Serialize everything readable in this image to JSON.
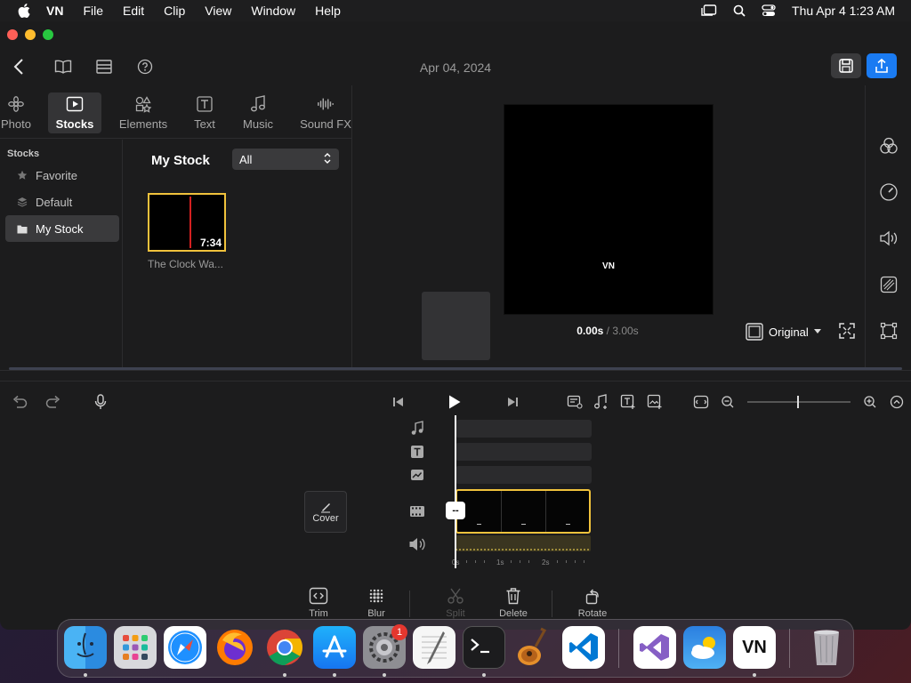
{
  "menubar": {
    "app_name": "VN",
    "menus": [
      "File",
      "Edit",
      "Clip",
      "View",
      "Window",
      "Help"
    ],
    "datetime": "Thu Apr 4  1:23 AM"
  },
  "window": {
    "title": "Apr 04, 2024"
  },
  "library": {
    "tabs": [
      {
        "label": "Photo",
        "icon": "photo-icon"
      },
      {
        "label": "Stocks",
        "icon": "stocks-icon",
        "active": true
      },
      {
        "label": "Elements",
        "icon": "elements-icon"
      },
      {
        "label": "Text",
        "icon": "text-icon"
      },
      {
        "label": "Music",
        "icon": "music-icon"
      },
      {
        "label": "Sound FX",
        "icon": "sound-fx-icon"
      }
    ],
    "sidebar": {
      "title": "Stocks",
      "items": [
        {
          "label": "Favorite",
          "icon": "star-icon"
        },
        {
          "label": "Default",
          "icon": "layers-icon"
        },
        {
          "label": "My Stock",
          "icon": "folder-icon",
          "active": true
        }
      ]
    },
    "main": {
      "heading": "My Stock",
      "filter": "All",
      "items": [
        {
          "duration": "7:34",
          "caption": "The Clock Wa..."
        }
      ]
    }
  },
  "preview": {
    "watermark": "VN",
    "time_current": "0.00s",
    "time_total": " / 3.00s",
    "ratio": "Original"
  },
  "timeline": {
    "cover_label": "Cover",
    "playhead_label": "--",
    "ruler": [
      "0s",
      "1s",
      "2s"
    ]
  },
  "edit_toolbar": [
    {
      "label": "Trim",
      "icon": "trim-icon"
    },
    {
      "label": "Blur",
      "icon": "blur-icon"
    },
    {
      "label": "Split",
      "icon": "scissors-icon",
      "disabled": true
    },
    {
      "label": "Delete",
      "icon": "trash-icon"
    },
    {
      "label": "Rotate",
      "icon": "rotate-icon"
    }
  ],
  "dock": {
    "badge_count": "1",
    "apps": [
      "Finder",
      "Launchpad",
      "Safari",
      "Firefox",
      "Chrome",
      "App Store",
      "System Preferences",
      "TextEdit",
      "Terminal",
      "GarageBand",
      "Visual Studio Code",
      "Visual Studio",
      "Weather",
      "VN",
      "Trash"
    ],
    "vn_label": "VN"
  },
  "colors": {
    "accent_blue": "#1a7bf2",
    "clip_yellow": "#f0c23c"
  }
}
